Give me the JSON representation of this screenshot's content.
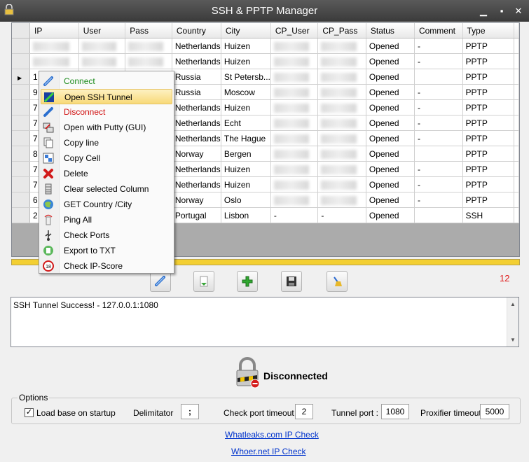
{
  "window": {
    "title": "SSH & PPTP Manager"
  },
  "grid": {
    "columns": [
      "IP",
      "User",
      "Pass",
      "Country",
      "City",
      "CP_User",
      "CP_Pass",
      "Status",
      "Comment",
      "Type"
    ],
    "rows": [
      {
        "ip": "",
        "country": "Netherlands",
        "city": "Huizen",
        "cp_user": "",
        "cp_pass": "",
        "status": "Opened",
        "comment": "-",
        "type": "PPTP"
      },
      {
        "ip": "",
        "country": "Netherlands",
        "city": "Huizen",
        "cp_user": "",
        "cp_pass": "",
        "status": "Opened",
        "comment": "-",
        "type": "PPTP"
      },
      {
        "ip": "1",
        "country": "Russia",
        "city": "St Petersb...",
        "cp_user": "",
        "cp_pass": "",
        "status": "Opened",
        "comment": "",
        "type": "PPTP"
      },
      {
        "ip": "9",
        "country": "Russia",
        "city": "Moscow",
        "cp_user": "",
        "cp_pass": "",
        "status": "Opened",
        "comment": "-",
        "type": "PPTP"
      },
      {
        "ip": "7",
        "country": "Netherlands",
        "city": "Huizen",
        "cp_user": "",
        "cp_pass": "",
        "status": "Opened",
        "comment": "-",
        "type": "PPTP"
      },
      {
        "ip": "7",
        "country": "Netherlands",
        "city": "Echt",
        "cp_user": "",
        "cp_pass": "",
        "status": "Opened",
        "comment": "-",
        "type": "PPTP"
      },
      {
        "ip": "7",
        "country": "Netherlands",
        "city": "The Hague",
        "cp_user": "",
        "cp_pass": "",
        "status": "Opened",
        "comment": "-",
        "type": "PPTP"
      },
      {
        "ip": "8",
        "country": "Norway",
        "city": "Bergen",
        "cp_user": "",
        "cp_pass": "",
        "status": "Opened",
        "comment": "",
        "type": "PPTP"
      },
      {
        "ip": "7",
        "country": "Netherlands",
        "city": "Huizen",
        "cp_user": "",
        "cp_pass": "",
        "status": "Opened",
        "comment": "-",
        "type": "PPTP"
      },
      {
        "ip": "7",
        "country": "Netherlands",
        "city": "Huizen",
        "cp_user": "",
        "cp_pass": "",
        "status": "Opened",
        "comment": "-",
        "type": "PPTP"
      },
      {
        "ip": "6",
        "country": "Norway",
        "city": "Oslo",
        "cp_user": "",
        "cp_pass": "",
        "status": "Opened",
        "comment": "-",
        "type": "PPTP"
      },
      {
        "ip": "2",
        "country": "Portugal",
        "city": "Lisbon",
        "cp_user": "-",
        "cp_pass": "-",
        "status": "Opened",
        "comment": "",
        "type": "SSH"
      }
    ]
  },
  "context_menu": {
    "items": [
      {
        "label": "Connect",
        "icon": "connect-icon",
        "color": "#1a8a1a"
      },
      {
        "label": "Open SSH Tunnel",
        "icon": "ssh-tunnel-icon",
        "color": "#000000"
      },
      {
        "label": "Disconnect",
        "icon": "disconnect-icon",
        "color": "#d01010"
      },
      {
        "label": "Open with Putty (GUI)",
        "icon": "putty-icon",
        "color": "#000000"
      },
      {
        "label": "Copy line",
        "icon": "copy-icon",
        "color": "#000000"
      },
      {
        "label": "Copy Cell",
        "icon": "copy-cell-icon",
        "color": "#000000"
      },
      {
        "label": "Delete",
        "icon": "delete-icon",
        "color": "#000000"
      },
      {
        "label": "Clear selected Column",
        "icon": "clear-column-icon",
        "color": "#000000"
      },
      {
        "label": "GET Country /City",
        "icon": "globe-icon",
        "color": "#000000"
      },
      {
        "label": "Ping All",
        "icon": "ping-icon",
        "color": "#000000"
      },
      {
        "label": "Check Ports",
        "icon": "usb-icon",
        "color": "#000000"
      },
      {
        "label": "Export to TXT",
        "icon": "export-icon",
        "color": "#000000"
      },
      {
        "label": "Check IP-Score",
        "icon": "score-icon",
        "color": "#000000"
      }
    ]
  },
  "toolbar": {
    "buttons": [
      "connect-icon",
      "import-icon",
      "add-icon",
      "save-icon",
      "broom-icon"
    ],
    "count": "12"
  },
  "log": {
    "text": "SSH Tunnel Success! - 127.0.0.1:1080"
  },
  "status": {
    "label": "Disconnected"
  },
  "options": {
    "legend": "Options",
    "load_base_label": "Load base on startup",
    "load_base_checked": true,
    "delimitator_label": "Delimitator",
    "delimitator_value": ";",
    "check_port_timeout_label": "Check port timeout :",
    "check_port_timeout_value": "2",
    "tunnel_port_label": "Tunnel port :",
    "tunnel_port_value": "1080",
    "proxifier_timeout_label": "Proxifier timeout :",
    "proxifier_timeout_value": "5000"
  },
  "links": {
    "whatleaks": "Whatleaks.com IP Check",
    "whoer": "Whoer.net IP Check"
  }
}
